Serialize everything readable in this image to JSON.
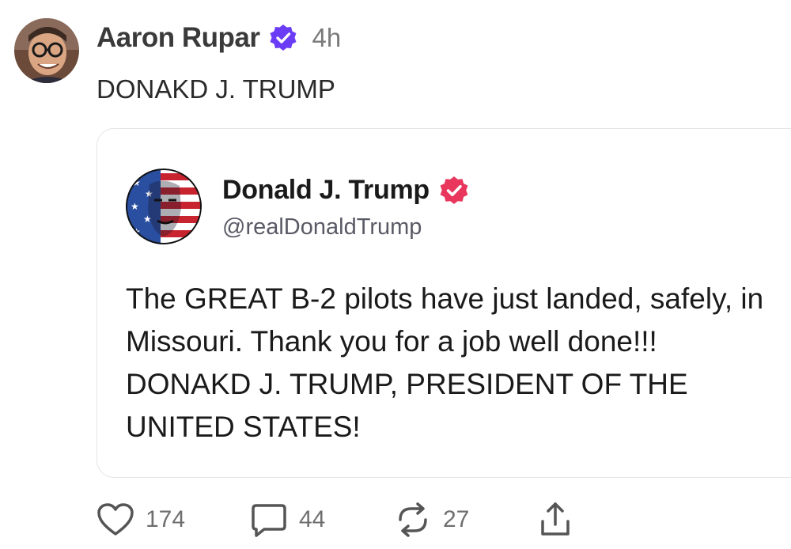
{
  "post": {
    "author_name": "Aaron Rupar",
    "time": "4h",
    "text": "DONAKD J. TRUMP"
  },
  "quote": {
    "author_name": "Donald J. Trump",
    "handle": "@realDonaldTrump",
    "text": "The GREAT B-2 pilots have just landed, safely, in Missouri. Thank you for a job well done!!! DONAKD J. TRUMP, PRESIDENT OF THE UNITED STATES!"
  },
  "actions": {
    "likes": "174",
    "replies": "44",
    "reposts": "27"
  },
  "colors": {
    "verified_purple": "#6b3cf5",
    "verified_red": "#e8365d",
    "icon_gray": "#555555"
  }
}
